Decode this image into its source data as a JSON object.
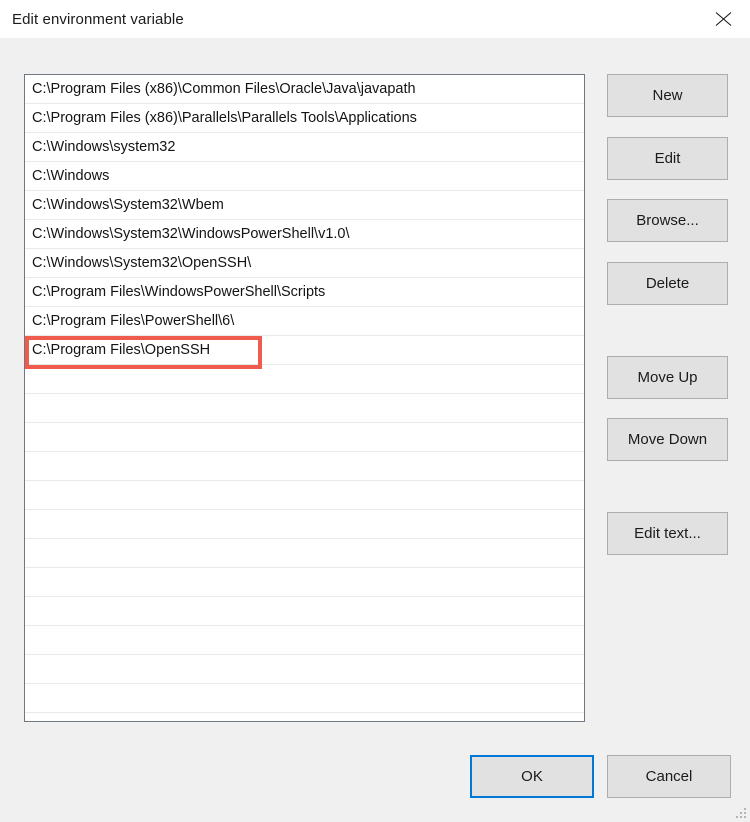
{
  "window": {
    "title": "Edit environment variable",
    "close_icon": "close-icon"
  },
  "path_list": {
    "entries": [
      "C:\\Program Files (x86)\\Common Files\\Oracle\\Java\\javapath",
      "C:\\Program Files (x86)\\Parallels\\Parallels Tools\\Applications",
      "C:\\Windows\\system32",
      "C:\\Windows",
      "C:\\Windows\\System32\\Wbem",
      "C:\\Windows\\System32\\WindowsPowerShell\\v1.0\\",
      "C:\\Windows\\System32\\OpenSSH\\",
      "C:\\Program Files\\WindowsPowerShell\\Scripts",
      "C:\\Program Files\\PowerShell\\6\\",
      "C:\\Program Files\\OpenSSH"
    ],
    "empty_row_count": 12,
    "highlighted_index": 9
  },
  "annotation": {
    "color": "#ef5b4c",
    "target_text": "C:\\Program Files\\OpenSSH"
  },
  "side_buttons": {
    "new_label": "New",
    "edit_label": "Edit",
    "browse_label": "Browse...",
    "delete_label": "Delete",
    "move_up_label": "Move Up",
    "move_down_label": "Move Down",
    "edit_text_label": "Edit text..."
  },
  "bottom_buttons": {
    "ok_label": "OK",
    "cancel_label": "Cancel",
    "focus_color": "#0078d7"
  }
}
